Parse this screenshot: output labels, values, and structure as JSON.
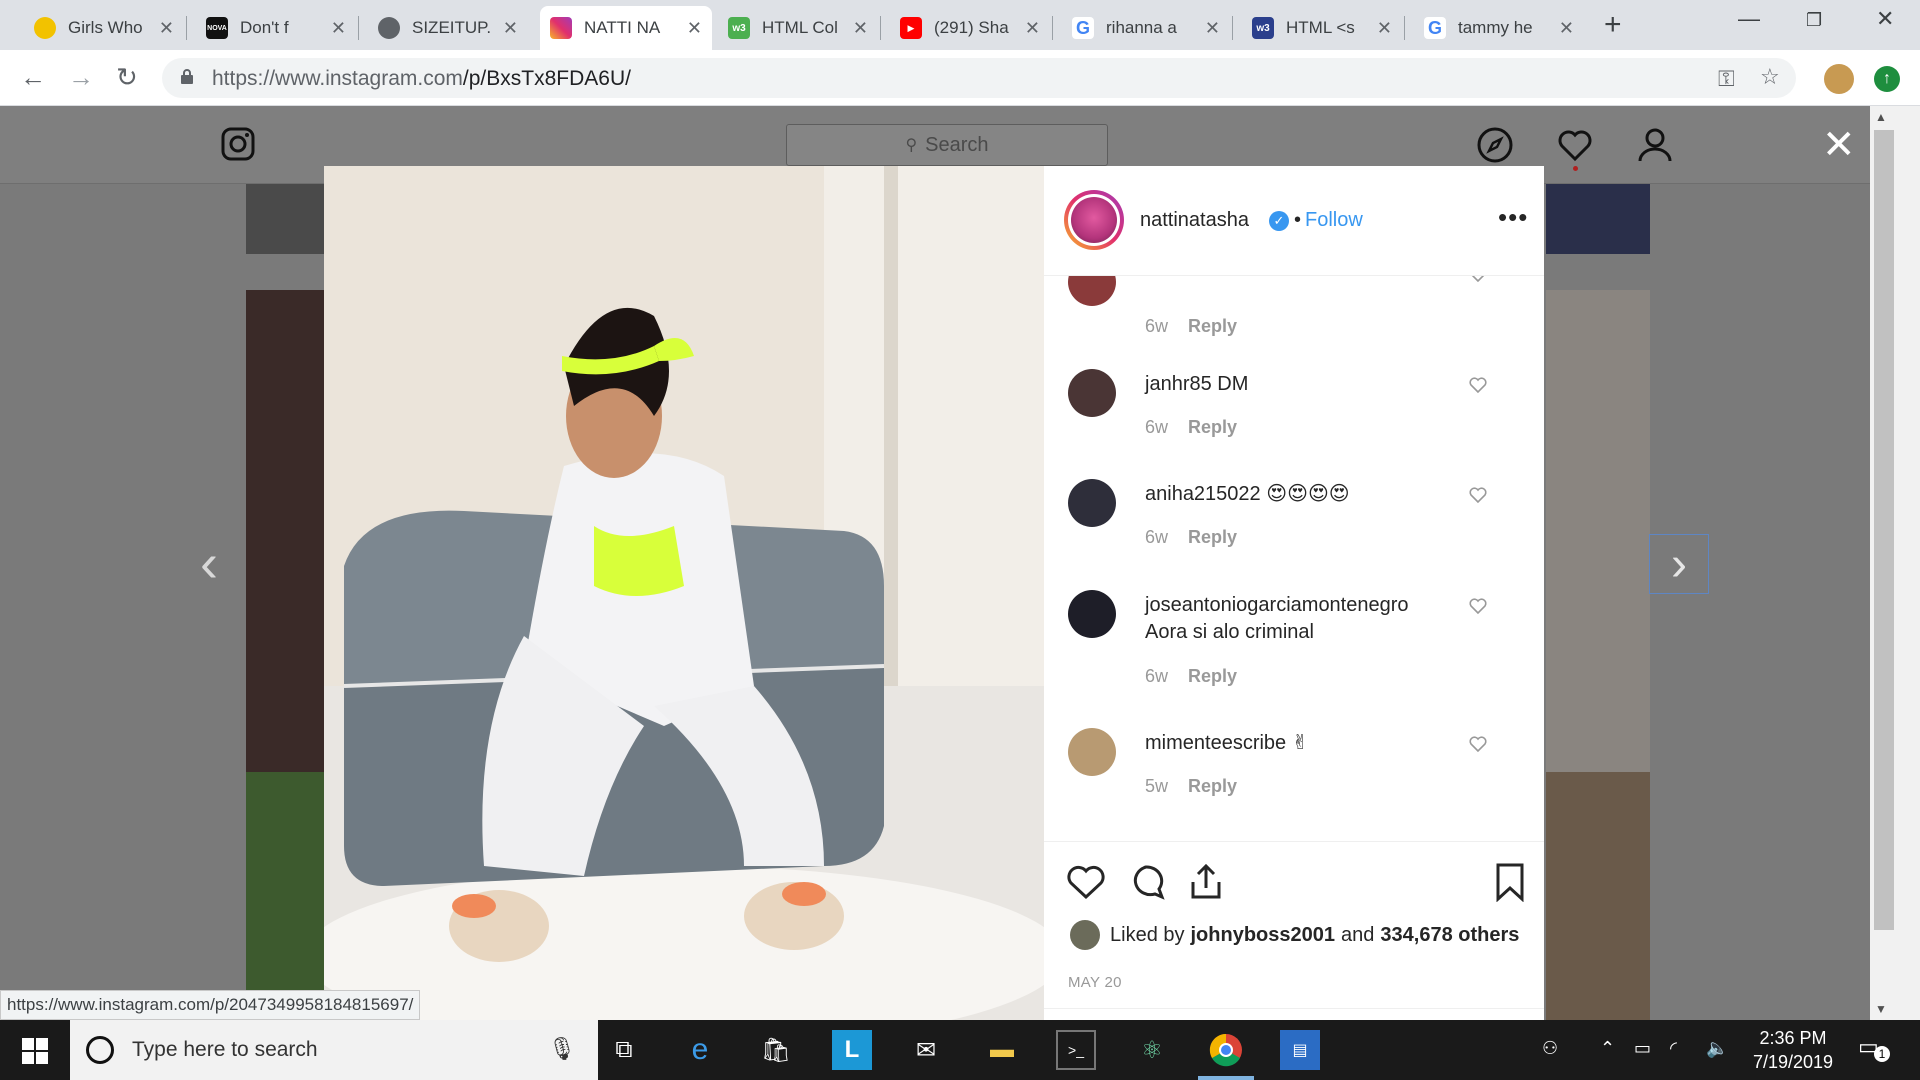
{
  "browser": {
    "tabs": [
      {
        "title": "Girls Who",
        "favicon_color": "#f2c200",
        "active": false
      },
      {
        "title": "Don't f",
        "favicon_color": "#111111",
        "active": false
      },
      {
        "title": "SIZEITUP.",
        "favicon_color": "#5f6368",
        "active": false
      },
      {
        "title": "NATTI NA",
        "favicon_color": "#c13584",
        "active": true
      },
      {
        "title": "HTML Col",
        "favicon_color": "#4caf50",
        "active": false
      },
      {
        "title": "(291) Sha",
        "favicon_color": "#ff0000",
        "active": false
      },
      {
        "title": "rihanna a",
        "favicon_color": "#4285f4",
        "active": false
      },
      {
        "title": "HTML <s",
        "favicon_color": "#2b3f8c",
        "active": false
      },
      {
        "title": "tammy he",
        "favicon_color": "#4285f4",
        "active": false
      }
    ],
    "url_prefix": "https://www.instagram.com",
    "url_path": "/p/BxsTx8FDA6U/",
    "status_url": "https://www.instagram.com/p/2047349958184815697/"
  },
  "instagram": {
    "search_placeholder": "Search",
    "post": {
      "username": "nattinatasha",
      "follow_label": "Follow",
      "comments": [
        {
          "user": "",
          "text": "",
          "time": "6w",
          "reply": "Reply",
          "avatar_color": "#8a3a3a"
        },
        {
          "user": "janhr85",
          "text": "DM",
          "time": "6w",
          "reply": "Reply",
          "avatar_color": "#4a3535"
        },
        {
          "user": "aniha215022",
          "text": "😍😍😍😍",
          "time": "6w",
          "reply": "Reply",
          "avatar_color": "#2e2e3a"
        },
        {
          "user": "joseantoniogarciamontenegro",
          "text": "Aora si alo criminal",
          "time": "6w",
          "reply": "Reply",
          "avatar_color": "#1e1e28"
        },
        {
          "user": "mimenteescribe",
          "text": "✌",
          "time": "5w",
          "reply": "Reply",
          "avatar_color": "#b89a72"
        }
      ],
      "liked_prefix": "Liked by",
      "liked_user": "johnyboss2001",
      "liked_and": "and",
      "liked_count": "334,678 others",
      "date": "MAY 20"
    }
  },
  "taskbar": {
    "search_text": "Type here to search",
    "time": "2:36 PM",
    "date": "7/19/2019",
    "notification_count": "1"
  }
}
